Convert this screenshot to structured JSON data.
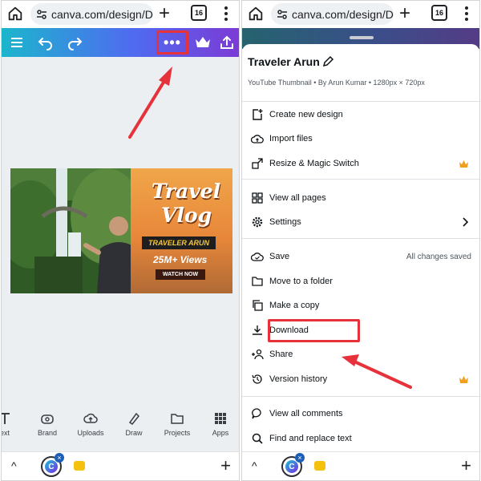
{
  "browser": {
    "url": "canva.com/design/DA",
    "tab_count": "16"
  },
  "left": {
    "thumbnail": {
      "title_line1": "Travel",
      "title_line2": "Vlog",
      "name_banner": "TRAVELER ARUN",
      "views": "25M+ Views",
      "cta": "WATCH NOW"
    },
    "bottom_nav": [
      {
        "label": "ext",
        "icon": "text-icon"
      },
      {
        "label": "Brand",
        "icon": "brand-icon"
      },
      {
        "label": "Uploads",
        "icon": "cloud-upload-icon"
      },
      {
        "label": "Draw",
        "icon": "pen-icon"
      },
      {
        "label": "Projects",
        "icon": "folder-icon"
      },
      {
        "label": "Apps",
        "icon": "grid-icon"
      }
    ]
  },
  "menu": {
    "title": "Traveler Arun",
    "subtitle": "YouTube Thumbnail • By Arun Kumar • 1280px × 720px",
    "items": [
      {
        "label": "Create new design",
        "icon": "plus-doc-icon"
      },
      {
        "label": "Import files",
        "icon": "cloud-upload-icon"
      },
      {
        "label": "Resize & Magic Switch",
        "icon": "resize-icon",
        "premium": true
      },
      {
        "label": "View all pages",
        "icon": "grid-icon"
      },
      {
        "label": "Settings",
        "icon": "gear-icon"
      },
      {
        "label": "Save",
        "icon": "cloud-check-icon",
        "status": "All changes saved"
      },
      {
        "label": "Move to a folder",
        "icon": "folder-icon"
      },
      {
        "label": "Make a copy",
        "icon": "copy-icon"
      },
      {
        "label": "Download",
        "icon": "download-icon"
      },
      {
        "label": "Share",
        "icon": "share-people-icon"
      },
      {
        "label": "Version history",
        "icon": "history-icon",
        "premium": true
      },
      {
        "label": "View all comments",
        "icon": "comment-icon"
      },
      {
        "label": "Find and replace text",
        "icon": "search-icon"
      }
    ]
  },
  "colors": {
    "highlight": "#e6323a",
    "premium_crown": "#f0a020",
    "toolbar_start": "#1bb6cc",
    "toolbar_end": "#7c3bd6"
  }
}
